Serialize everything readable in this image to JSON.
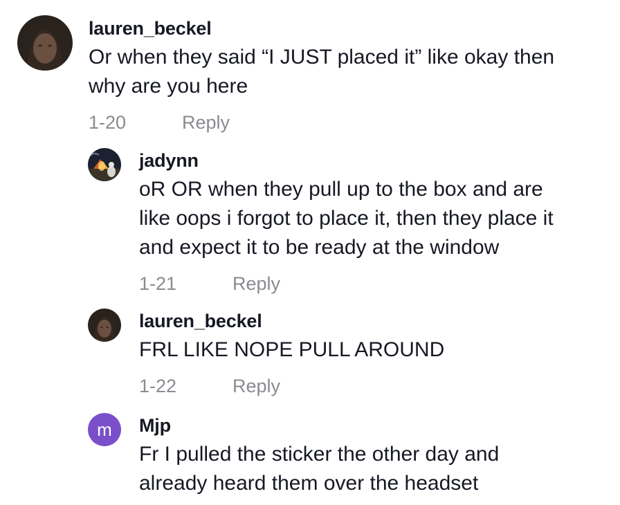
{
  "comments": [
    {
      "username": "lauren_beckel",
      "text": "Or when they said “I JUST placed it” like okay then\nwhy are you here",
      "date": "1-20",
      "reply_label": "Reply"
    },
    {
      "username": "jadynn",
      "text": "oR OR when they pull up to the box and are\nlike oops i forgot to place it, then they place it\nand expect it to be ready at the window",
      "date": "1-21",
      "reply_label": "Reply"
    },
    {
      "username": "lauren_beckel",
      "text": "FRL LIKE NOPE PULL AROUND",
      "date": "1-22",
      "reply_label": "Reply"
    },
    {
      "username": "Mjp",
      "avatar_letter": "m",
      "text": "Fr I pulled the sticker the other day and\nalready heard them over the headset"
    }
  ],
  "colors": {
    "text": "#161823",
    "meta": "#8a8b91",
    "letter_avatar": "#7a4fc9"
  }
}
